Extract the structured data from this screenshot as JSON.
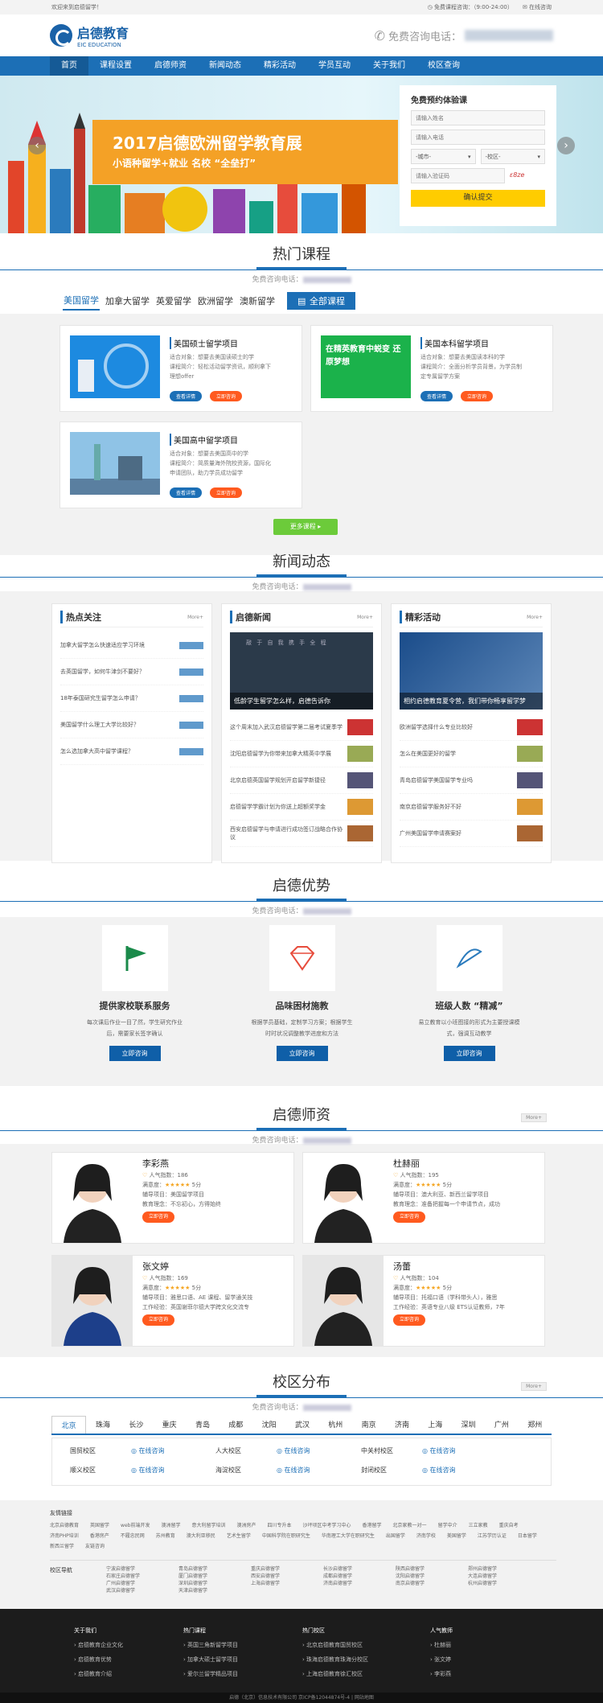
{
  "topbar": {
    "welcome": "欢迎来到启德留学！",
    "service": "免费课程咨询：（9:00-24:00）",
    "online": "在线咨询"
  },
  "header": {
    "logo_cn": "启德教育",
    "logo_en": "EIC EDUCATION",
    "hotline": "免费咨询电话："
  },
  "nav": [
    "首页",
    "课程设置",
    "启德师资",
    "新闻动态",
    "精彩活动",
    "学员互动",
    "关于我们",
    "校区查询"
  ],
  "banner": {
    "title": "2017启德欧洲留学教育展",
    "subtitle": "小语种留学+就业   名校 “全垒打”"
  },
  "form": {
    "title": "免费预约体验课",
    "name_ph": "请输入姓名",
    "phone_ph": "请输入电话",
    "city": "-城市-",
    "campus": "-校区-",
    "code_ph": "请输入验证码",
    "code": "ε8ze",
    "submit": "确认提交"
  },
  "courses": {
    "title": "热门课程",
    "tel_label": "免费咨询电话：",
    "tabs": [
      "美国留学",
      "加拿大留学",
      "英爱留学",
      "欧洲留学",
      "澳新留学"
    ],
    "all_btn": "全部课程",
    "items": [
      {
        "title": "美国硕士留学项目",
        "l1": "适合对象：想要去美国读硕士的学",
        "l2": "课程简介：轻松活动留学资讯，顺利拿下",
        "l3": "理想offer"
      },
      {
        "title": "美国本科留学项目",
        "l1": "适合对象：想要去美国读本科的学",
        "l2": "课程简介：全面分析学员背景，为学员制",
        "l3": "定专属留学方案",
        "img": "在精英教育中蜕变 还原梦想"
      },
      {
        "title": "美国高中留学项目",
        "l1": "适合对象：想要去美国高中的学",
        "l2": "课程简介：简质量海外院校资源，国际化",
        "l3": "申请团队，助力学员成功留学"
      }
    ],
    "detail": "查看详情",
    "apply": "立即咨询",
    "more": "更多课程"
  },
  "news": {
    "title": "新闻动态",
    "tel_label": "免费咨询电话：",
    "hot": {
      "title": "热点关注",
      "more": "More+",
      "items": [
        "加拿大留学怎么快速适应学习环境",
        "去英国留学，如何牛津剑不要好？",
        "18年泰国研究生留学怎么申请？",
        "美国留学什么理工大学比较好？",
        "怎么选加拿大高中留学课程？"
      ]
    },
    "eic": {
      "title": "启德新闻",
      "more": "More+",
      "feature": "低龄学生留学怎么样，启德告诉你",
      "feature_img": "敲 于 自 我   携 手 全 程",
      "items": [
        "这个周末加入武汉启德留学第二届考试夏季学",
        "沈阳启德留学为你带来加拿大精英中学展",
        "北京启德英国留学规划开启留学新捷径",
        "启德留学学霸计划为你送上超额奖学金",
        "西安启德留学与申请进行成功签订战略合作协议"
      ]
    },
    "act": {
      "title": "精彩活动",
      "more": "More+",
      "feature": "相约启德教育夏令营，我们带你畅享留学梦",
      "items": [
        "欧洲留学选择什么专业比较好",
        "怎么在美国更好的留学",
        "青岛启德留学美国留学专业吗",
        "南京启德留学服务好不好",
        "广州美国留学申请赛案好"
      ]
    }
  },
  "adv": {
    "title": "启德优势",
    "tel_label": "免费咨询电话：",
    "items": [
      {
        "t": "提供家校联系服务",
        "d1": "每次课后作业一目了然，学生研究作业",
        "d2": "后，需要家长签字确认"
      },
      {
        "t": "品味困材施教",
        "d1": "根据学员基础，定制学习方案；根据学生",
        "d2": "时时状况调整教学进度和方法"
      },
      {
        "t": "班级人数 “精减”",
        "d1": "易立教育以小班图接的形式为主要授课模",
        "d2": "式，强调互动教学"
      }
    ],
    "btn": "立即咨询"
  },
  "teachers": {
    "title": "启德师资",
    "more": "More+",
    "tel_label": "免费咨询电话：",
    "items": [
      {
        "name": "李彩燕",
        "pop": "人气指数：186",
        "sat": "满意度：",
        "score": "5分",
        "proj": "辅导项目：美国留学项目",
        "idea": "教育理念：不忘初心，方得始终"
      },
      {
        "name": "杜赫丽",
        "pop": "人气指数：195",
        "sat": "满意度：",
        "score": "5分",
        "proj": "辅导项目：澳大利亚、新西兰留学项目",
        "idea": "教育理念：准备把握每一个申请节点，成功"
      },
      {
        "name": "张文婷",
        "pop": "人气指数：169",
        "sat": "满意度：",
        "score": "5分",
        "proj": "辅导项目：雅思口语、AE 课程、留学通关技",
        "idea": "工作经验：英国谢菲尔德大学跨文化交流专"
      },
      {
        "name": "汤蕾",
        "pop": "人气指数：104",
        "sat": "满意度：",
        "score": "5分",
        "proj": "辅导项目：托福口语（学科带头人），雅思",
        "idea": "工作经验：英语专业八级 ETS认证教师，7年"
      }
    ],
    "btn": "立即咨询"
  },
  "campus": {
    "title": "校区分布",
    "more": "More+",
    "tel_label": "免费咨询电话：",
    "cities": [
      "北京",
      "珠海",
      "长沙",
      "重庆",
      "青岛",
      "成都",
      "沈阳",
      "武汉",
      "杭州",
      "南京",
      "济南",
      "上海",
      "深圳",
      "广州",
      "郑州"
    ],
    "rows": [
      [
        "国贸校区",
        "在线咨询",
        "人大校区",
        "在线咨询",
        "中关村校区",
        "在线咨询"
      ],
      [
        "顺义校区",
        "在线咨询",
        "海淀校区",
        "在线咨询",
        "封闭校区",
        "在线咨询"
      ]
    ]
  },
  "links": {
    "title": "友情链接",
    "items": [
      "北京启德教育",
      "英国留学",
      "web前端开发",
      "澳洲留学",
      "意大利留学培训",
      "澳洲房产",
      "四川专升本",
      "沙坪坝区中考学习中心",
      "香港留学",
      "北京家教一对一",
      "留学中介",
      "三立家教",
      "重庆自考",
      "济南PHP培训",
      "香港房产",
      "不履忠民网",
      "苏州教育",
      "澳大利亚移民",
      "艺术生留学",
      "中国科学院在职研究生",
      "华南理工大学在职研究生",
      "出国留学",
      "济南学校",
      "美国留学",
      "江苏学历认证",
      "日本留学",
      "新西兰留学",
      "友链咨询"
    ],
    "campus_title": "校区导航",
    "campus_items": [
      "宁波启德留学",
      "青岛启德留学",
      "重庆启德留学",
      "长沙启德留学",
      "陕西启德留学",
      "郑州启德留学",
      "石家庄启德留学",
      "厦门启德留学",
      "西安启德留学",
      "成都启德留学",
      "沈阳启德留学",
      "大连启德留学",
      "广州启德留学",
      "深圳启德留学",
      "上海启德留学",
      "济南启德留学",
      "南京启德留学",
      "杭州启德留学",
      "武汉启德留学",
      "天津启德留学"
    ]
  },
  "footer": {
    "cols": [
      {
        "t": "关于我们",
        "i": [
          "启德教育企业文化",
          "启德教育优势",
          "启德教育介绍"
        ]
      },
      {
        "t": "热门课程",
        "i": [
          "英国三角新留学项目",
          "加拿大硕士留学项目",
          "爱尔兰留学精品项目"
        ]
      },
      {
        "t": "热门校区",
        "i": [
          "北京启德教育国贸校区",
          "珠海启德教育珠海分校区",
          "上海启德教育徐汇校区"
        ]
      },
      {
        "t": "人气教师",
        "i": [
          "杜赫丽",
          "张文婷",
          "李彩燕"
        ]
      }
    ],
    "copyright": "启德（北京）信息技术有限公司  京ICP备12044874号-4  |  网站地图"
  }
}
